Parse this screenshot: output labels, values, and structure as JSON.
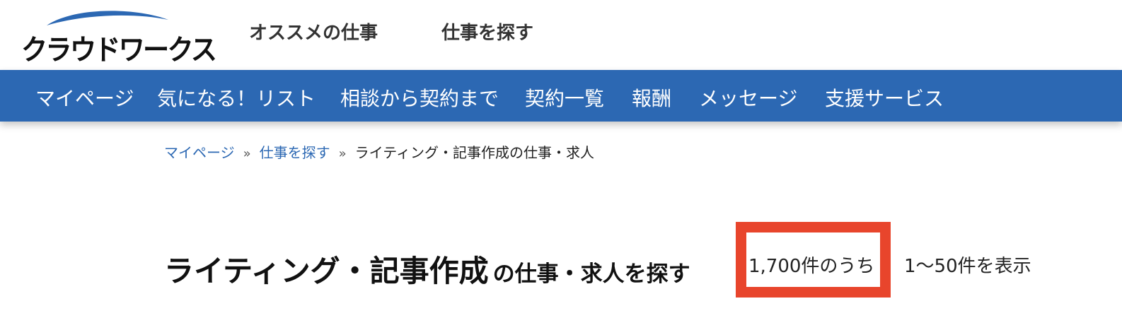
{
  "header": {
    "logo_text": "クラウドワークス",
    "nav": [
      "オススメの仕事",
      "仕事を探す"
    ]
  },
  "menu": {
    "items": [
      "マイページ",
      "気になる！リスト",
      "相談から契約まで",
      "契約一覧",
      "報酬",
      "メッセージ",
      "支援サービス"
    ]
  },
  "breadcrumb": {
    "items": [
      "マイページ",
      "仕事を探す"
    ],
    "separator": "»",
    "current": "ライティング・記事作成の仕事・求人"
  },
  "search": {
    "category": "ライティング・記事作成",
    "suffix": "の仕事・求人を探す",
    "total": "1,700件のうち",
    "range": "1〜50件を表示"
  },
  "colors": {
    "brand_blue": "#2c68b3",
    "highlight_red": "#e8452c"
  }
}
